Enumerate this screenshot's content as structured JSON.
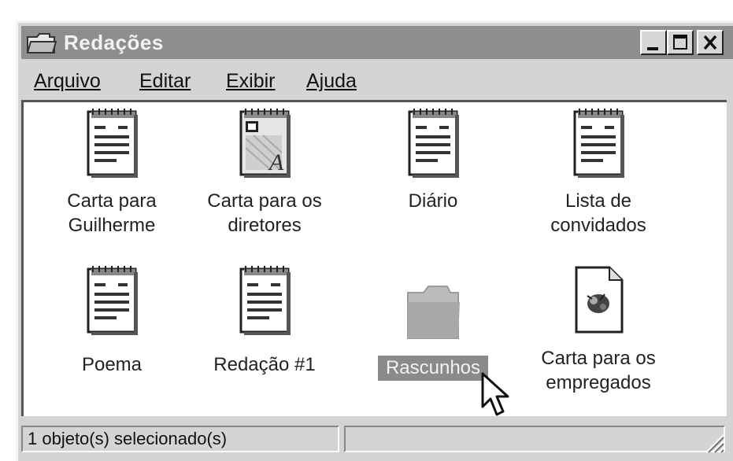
{
  "window": {
    "title": "Redações",
    "title_icon": "folder-icon",
    "controls": [
      "minimize-icon",
      "maximize-icon",
      "close-icon"
    ]
  },
  "menu": {
    "items": [
      "Arquivo",
      "Editar",
      "Exibir",
      "Ajuda"
    ]
  },
  "files": [
    {
      "label": "Carta para\nGuilherme",
      "icon": "notepad-document-icon",
      "selected": false
    },
    {
      "label": "Carta para os\ndiretores",
      "icon": "wordpad-document-icon",
      "selected": false
    },
    {
      "label": "Diário",
      "icon": "notepad-document-icon",
      "selected": false
    },
    {
      "label": "Lista de\nconvidados",
      "icon": "notepad-document-icon",
      "selected": false
    },
    {
      "label": "Poema",
      "icon": "notepad-document-icon",
      "selected": false
    },
    {
      "label": "Redação #1",
      "icon": "notepad-document-icon",
      "selected": false
    },
    {
      "label": "Rascunhos",
      "icon": "folder-icon",
      "selected": true
    },
    {
      "label": "Carta para os\nempregados",
      "icon": "paint-document-icon",
      "selected": false
    }
  ],
  "status": {
    "text": "1 objeto(s) selecionado(s)"
  },
  "colors": {
    "titlebar": "#8e8e8e",
    "window_face": "#d4d4d4",
    "selection": "#8a8a8a"
  }
}
